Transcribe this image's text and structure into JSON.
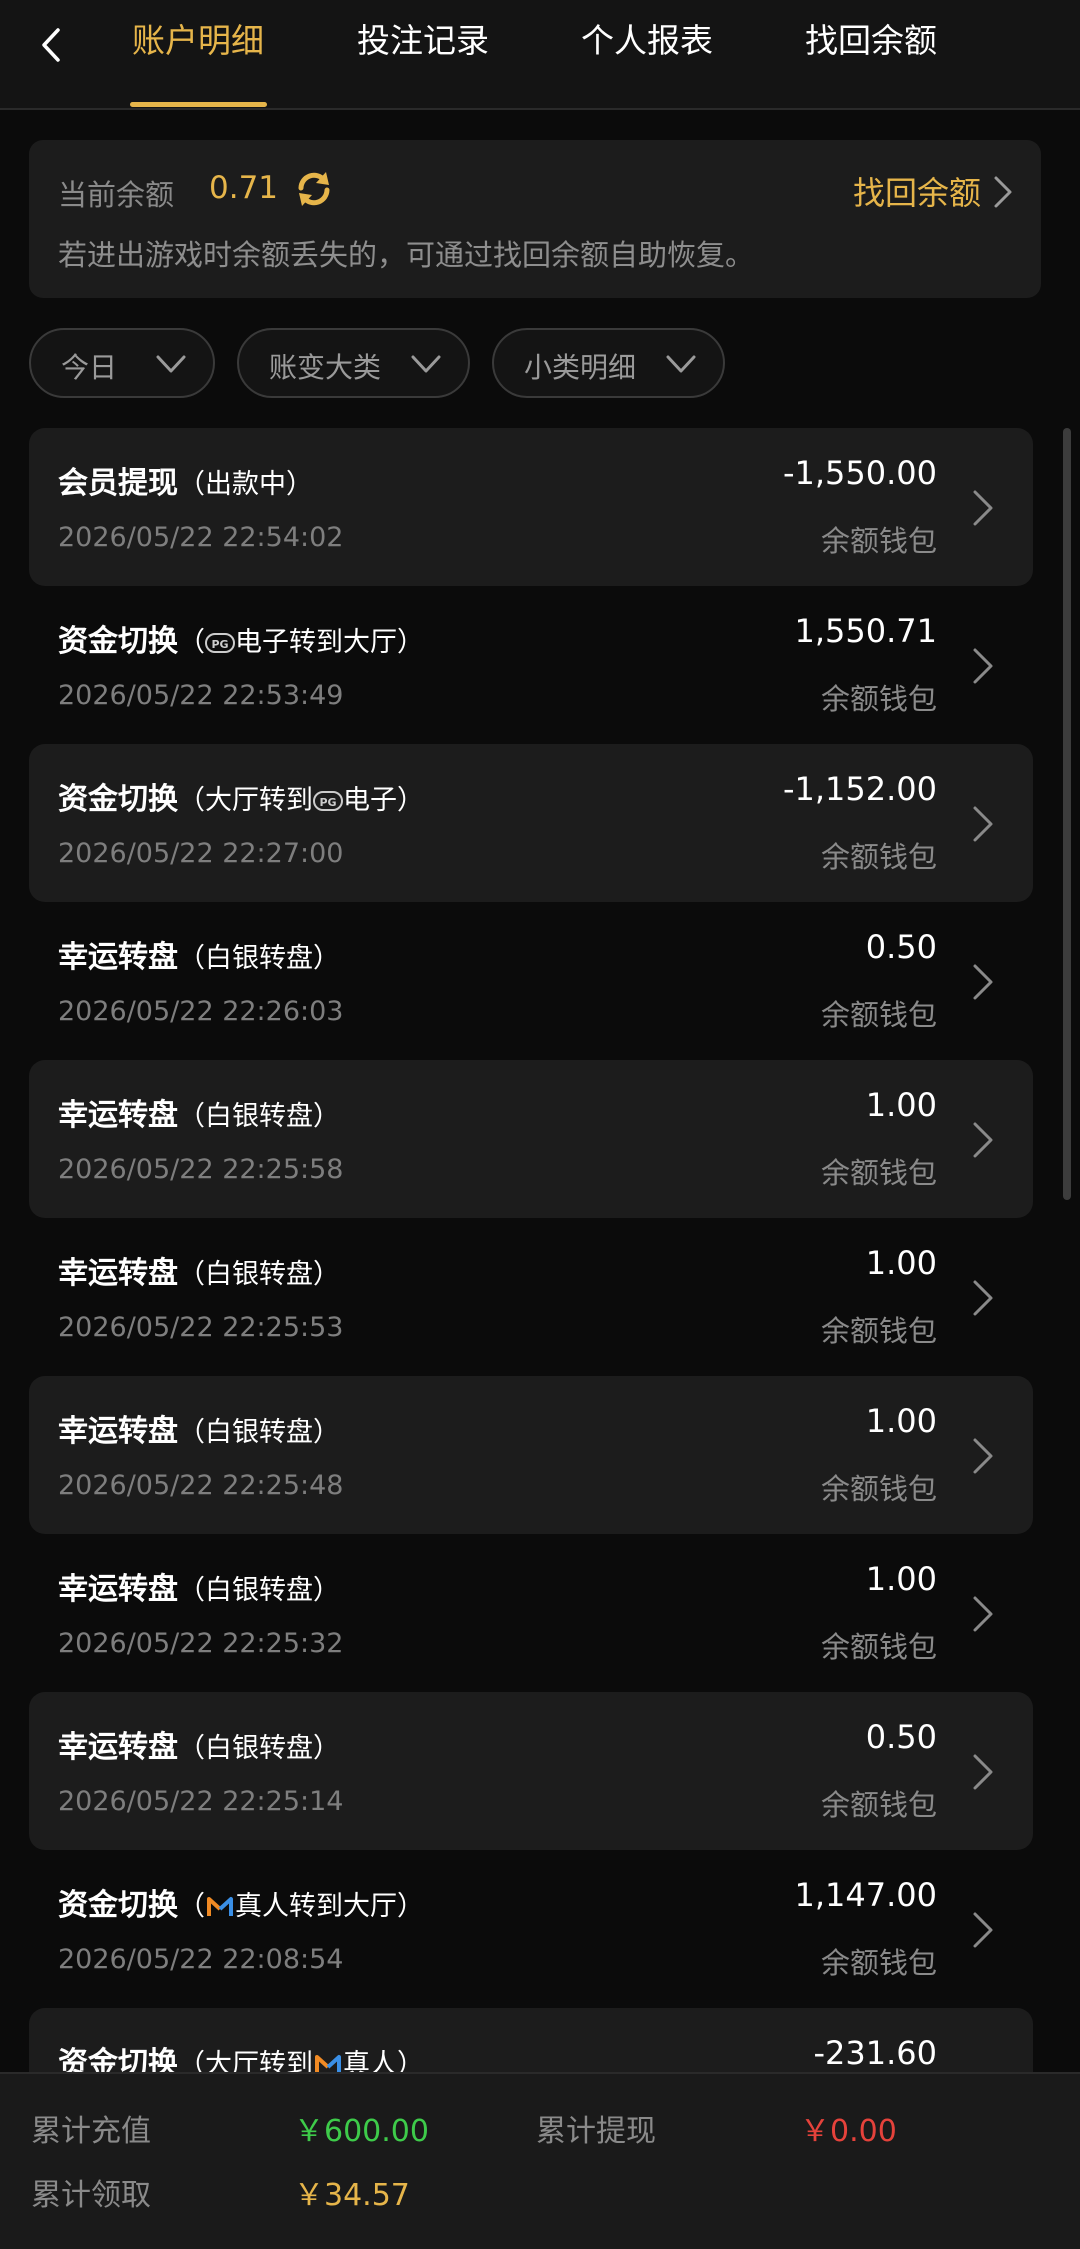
{
  "nav": {
    "tabs": [
      {
        "label": "账户明细",
        "active": true
      },
      {
        "label": "投注记录",
        "active": false
      },
      {
        "label": "个人报表",
        "active": false
      },
      {
        "label": "找回余额",
        "active": false
      }
    ],
    "back_icon": "chevron-left-icon"
  },
  "balance": {
    "label": "当前余额",
    "value": "0.71",
    "refresh_icon": "refresh-icon",
    "recover_label": "找回余额",
    "hint": "若进出游戏时余额丢失的，可通过找回余额自助恢复。"
  },
  "filters": [
    {
      "label": "今日"
    },
    {
      "label": "账变大类"
    },
    {
      "label": "小类明细"
    }
  ],
  "records": [
    {
      "title": "会员提现",
      "pre": "（出款中）",
      "icon": "",
      "post": "",
      "date": "2026/05/22 22:54:02",
      "amount": "-1,550.00",
      "wallet": "余额钱包"
    },
    {
      "title": "资金切换",
      "pre": "（",
      "icon": "pg",
      "post": "电子转到大厅）",
      "date": "2026/05/22 22:53:49",
      "amount": "1,550.71",
      "wallet": "余额钱包"
    },
    {
      "title": "资金切换",
      "pre": "（大厅转到",
      "icon": "pg",
      "post": "电子）",
      "date": "2026/05/22 22:27:00",
      "amount": "-1,152.00",
      "wallet": "余额钱包"
    },
    {
      "title": "幸运转盘",
      "pre": "（白银转盘）",
      "icon": "",
      "post": "",
      "date": "2026/05/22 22:26:03",
      "amount": "0.50",
      "wallet": "余额钱包"
    },
    {
      "title": "幸运转盘",
      "pre": "（白银转盘）",
      "icon": "",
      "post": "",
      "date": "2026/05/22 22:25:58",
      "amount": "1.00",
      "wallet": "余额钱包"
    },
    {
      "title": "幸运转盘",
      "pre": "（白银转盘）",
      "icon": "",
      "post": "",
      "date": "2026/05/22 22:25:53",
      "amount": "1.00",
      "wallet": "余额钱包"
    },
    {
      "title": "幸运转盘",
      "pre": "（白银转盘）",
      "icon": "",
      "post": "",
      "date": "2026/05/22 22:25:48",
      "amount": "1.00",
      "wallet": "余额钱包"
    },
    {
      "title": "幸运转盘",
      "pre": "（白银转盘）",
      "icon": "",
      "post": "",
      "date": "2026/05/22 22:25:32",
      "amount": "1.00",
      "wallet": "余额钱包"
    },
    {
      "title": "幸运转盘",
      "pre": "（白银转盘）",
      "icon": "",
      "post": "",
      "date": "2026/05/22 22:25:14",
      "amount": "0.50",
      "wallet": "余额钱包"
    },
    {
      "title": "资金切换",
      "pre": "（",
      "icon": "live",
      "post": "真人转到大厅）",
      "date": "2026/05/22 22:08:54",
      "amount": "1,147.00",
      "wallet": "余额钱包"
    },
    {
      "title": "资金切换",
      "pre": "（大厅转到",
      "icon": "live",
      "post": "真人）",
      "date": "",
      "amount": "-231.60",
      "wallet": ""
    }
  ],
  "summary": {
    "recharge_label": "累计充值",
    "recharge_value": "￥600.00",
    "withdraw_label": "累计提现",
    "withdraw_value": "￥0.00",
    "claim_label": "累计领取",
    "claim_value": "￥34.57"
  },
  "colors": {
    "accent": "#e6b54a",
    "recharge": "#3ecb4a",
    "withdraw": "#e5423b",
    "claim": "#e6b54a"
  }
}
